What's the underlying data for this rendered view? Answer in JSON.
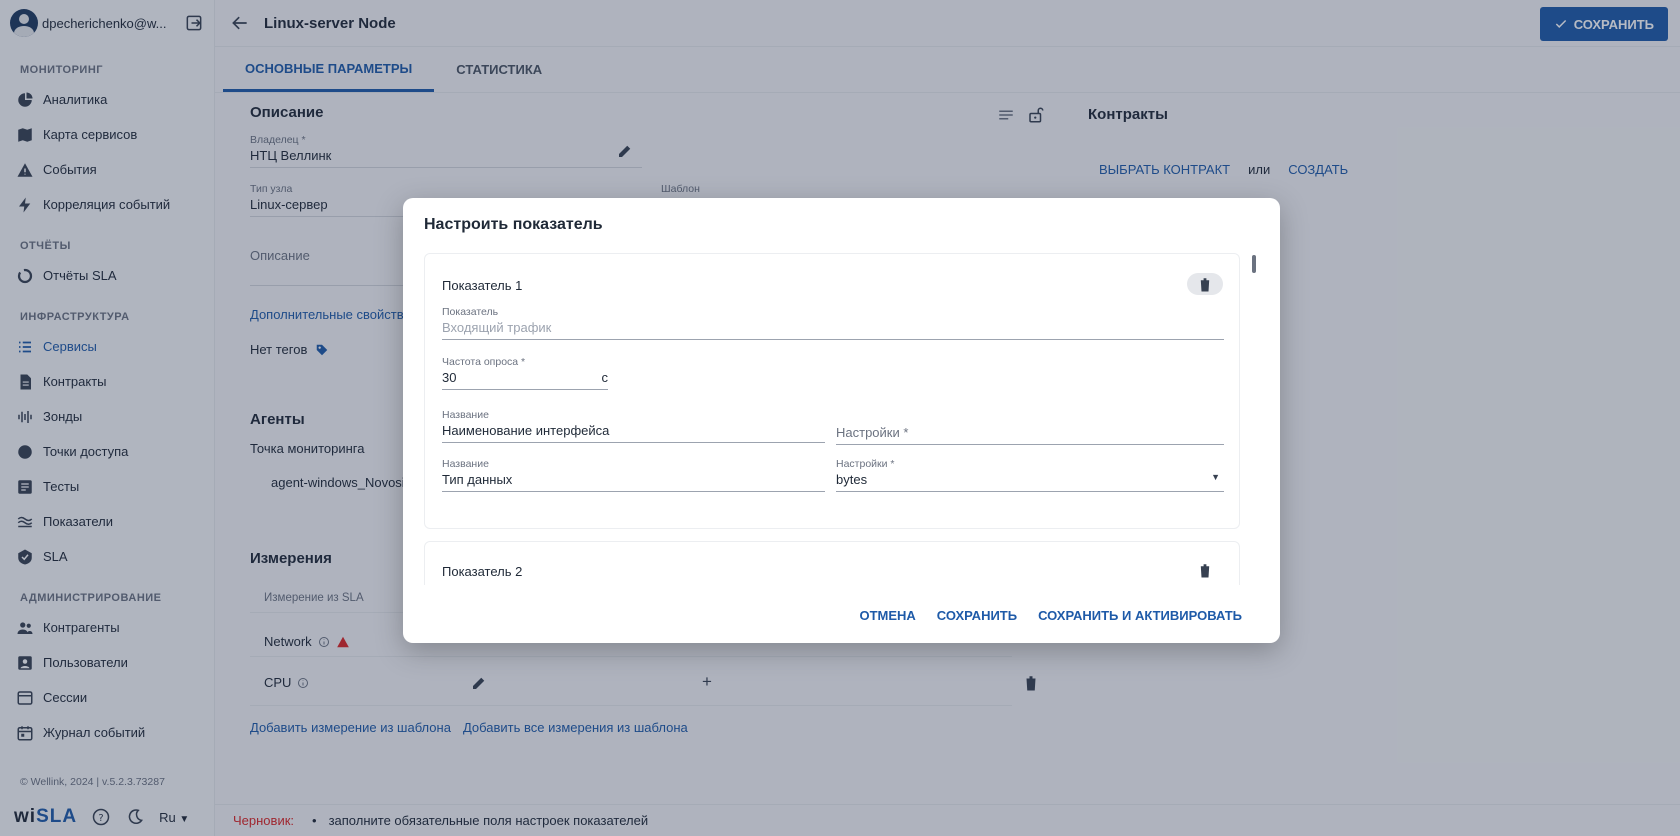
{
  "user": {
    "name": "dpecherichenko@w..."
  },
  "sidebar": {
    "sections": [
      {
        "title": "МОНИТОРИНГ",
        "items": [
          "Аналитика",
          "Карта сервисов",
          "События",
          "Корреляция событий"
        ]
      },
      {
        "title": "ОТЧЁТЫ",
        "items": [
          "Отчёты SLA"
        ]
      },
      {
        "title": "ИНФРАСТРУКТУРА",
        "items": [
          "Сервисы",
          "Контракты",
          "Зонды",
          "Точки доступа",
          "Тесты",
          "Показатели",
          "SLA"
        ]
      },
      {
        "title": "АДМИНИСТРИРОВАНИЕ",
        "items": [
          "Контрагенты",
          "Пользователи",
          "Сессии",
          "Журнал событий"
        ]
      }
    ],
    "copyright": "© Wellink, 2024 | v.5.2.3.73287",
    "logo_prefix": "wi",
    "logo_suffix": "SLA",
    "lang": "Ru"
  },
  "header": {
    "title": "Linux-server Node",
    "save_label": "СОХРАНИТЬ"
  },
  "tabs": [
    "ОСНОВНЫЕ ПАРАМЕТРЫ",
    "СТАТИСТИКА"
  ],
  "description": {
    "title": "Описание",
    "owner_label": "Владелец *",
    "owner_value": "НТЦ Веллинк",
    "node_type_label": "Тип узла",
    "node_type_value": "Linux-сервер",
    "template_label": "Шаблон",
    "desc_placeholder": "Описание",
    "extra_props": "Дополнительные свойства",
    "no_tags": "Нет тегов"
  },
  "contracts": {
    "title": "Контракты",
    "choose": "ВЫБРАТЬ КОНТРАКТ",
    "or": "или",
    "create": "СОЗДАТЬ"
  },
  "agents": {
    "title": "Агенты",
    "point_label": "Точка мониторинга",
    "agent": "agent-windows_Novosi"
  },
  "measurements": {
    "title": "Измерения",
    "col_header": "Измерение из SLA",
    "rows": [
      "Network",
      "CPU"
    ],
    "add_from_template": "Добавить измерение из шаблона",
    "add_all_from_template": "Добавить все измерения из шаблона"
  },
  "status": {
    "draft": "Черновик:",
    "message": "заполните обязательные поля настроек показателей"
  },
  "modal": {
    "title": "Настроить показатель",
    "metric1": {
      "title": "Показатель 1",
      "metric_label": "Показатель",
      "metric_value": "Входящий трафик",
      "freq_label": "Частота опроса *",
      "freq_value": "30",
      "freq_unit": "с",
      "name1_label": "Название",
      "name1_value": "Наименование интерфейса",
      "settings1_placeholder": "Настройки *",
      "name2_label": "Название",
      "name2_value": "Тип данных",
      "settings2_label": "Настройки *",
      "settings2_value": "bytes"
    },
    "metric2": {
      "title": "Показатель 2"
    },
    "cancel": "ОТМЕНА",
    "save": "СОХРАНИТЬ",
    "save_activate": "СОХРАНИТЬ И АКТИВИРОВАТЬ"
  }
}
